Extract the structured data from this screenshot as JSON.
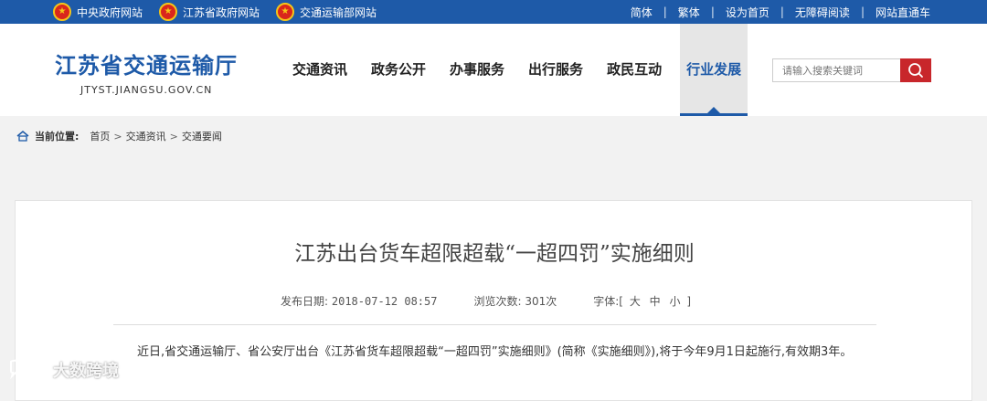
{
  "topbar": {
    "left_links": [
      "中央政府网站",
      "江苏省政府网站",
      "交通运输部网站"
    ],
    "right_links": [
      "简体",
      "繁体",
      "设为首页",
      "无障碍阅读",
      "网站直通车"
    ],
    "separator": "|",
    "background": "#1e5aa8"
  },
  "header": {
    "logo_cn": "江苏省交通运输厅",
    "logo_en": "JTYST.JIANGSU.GOV.CN",
    "nav": [
      "交通资讯",
      "政务公开",
      "办事服务",
      "出行服务",
      "政民互动",
      "行业发展"
    ],
    "active_nav": "行业发展",
    "search_placeholder": "请输入搜索关键词",
    "accent_color": "#1e5aa8",
    "search_button_color": "#c8262b"
  },
  "breadcrumb": {
    "label": "当前位置:",
    "items": [
      "首页",
      "交通资讯",
      "交通要闻"
    ],
    "separator": ">"
  },
  "article": {
    "title": "江苏出台货车超限超载“一超四罚”实施细则",
    "publish_label": "发布日期:",
    "publish_date": "2018-07-12 08:57",
    "views_label": "浏览次数:",
    "views": "301次",
    "font_label": "字体:[",
    "font_sizes": [
      "大",
      "中",
      "小"
    ],
    "font_close": "]",
    "body": "近日,省交通运输厅、省公安厅出台《江苏省货车超限超载“一超四罚”实施细则》(简称《实施细则》),将于今年9月1日起施行,有效期3年。"
  },
  "watermark": {
    "text": "大数跨境",
    "icon": "chat-bubbles-icon"
  }
}
